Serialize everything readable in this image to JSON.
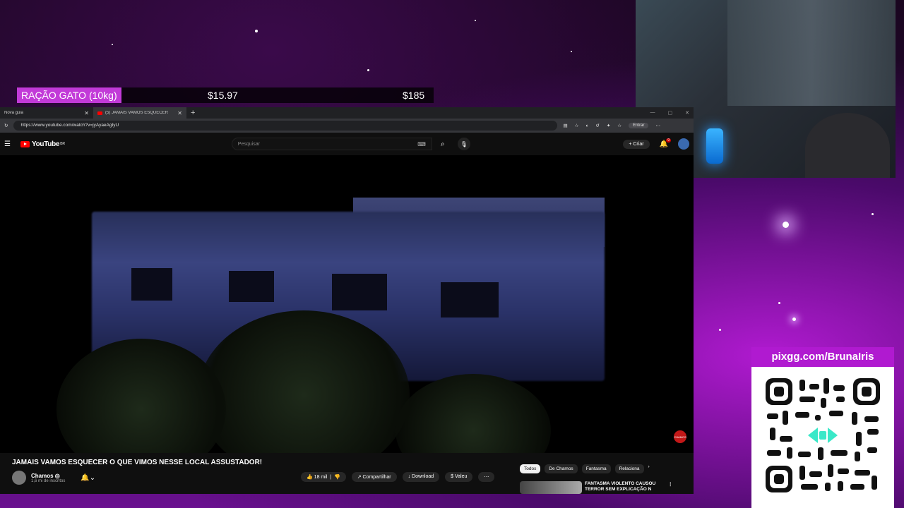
{
  "ticker": {
    "item": "RAÇÃO GATO (10kg)",
    "price_current": "$15.97",
    "price_goal": "$185"
  },
  "browser": {
    "tabs": [
      {
        "label": "Nova guia"
      },
      {
        "label": "(5) JAMAIS VAMOS ESQUECER"
      }
    ],
    "url": "https://www.youtube.com/watch?v=jyAyaeAgIyU",
    "signin_label": "Entrar"
  },
  "youtube": {
    "logo_text": "YouTube",
    "logo_region": "BR",
    "search_placeholder": "Pesquisar",
    "create_label": "Criar",
    "notification_count": "9",
    "video_title": "JAMAIS VAMOS ESQUECER O QUE VIMOS NESSE LOCAL ASSUSTADOR!",
    "channel_name": "Chamos ◎",
    "channel_subs": "1,6 mi de inscritos",
    "actions": {
      "likes": "18 mil",
      "share": "Compartilhar",
      "download": "Download",
      "thanks": "Valeu"
    },
    "chips": [
      "Todos",
      "De Chamos",
      "Fantasma",
      "Relaciona"
    ],
    "recommendation_title": "FANTASMA VIOLENTO CAUSOU TERROR SEM EXPLICAÇÃO N",
    "video_badge": "CHAMOS"
  },
  "qr_panel": {
    "url": "pixgg.com/BrunaIris"
  },
  "colors": {
    "accent": "#b01ad0",
    "youtube_red": "#ff0000"
  }
}
